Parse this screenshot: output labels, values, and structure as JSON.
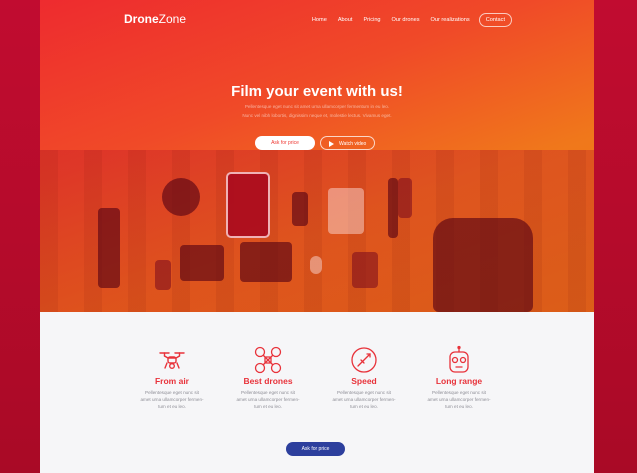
{
  "brand": {
    "bold": "Drone",
    "light": "Zone"
  },
  "nav": [
    "Home",
    "About",
    "Pricing",
    "Our drones",
    "Our realizations",
    "Contact"
  ],
  "hero": {
    "title": "Film your event with us!",
    "subtitle_1": "Pellentesque eget nunc sit amet urna ullamcorper fermentum in eu leo.",
    "subtitle_2": "Nunc vel nibh lobortis, dignissim neque et, molestie lectus. Vivamus eget.",
    "ask_label": "Ask for price",
    "video_label": "Watch video"
  },
  "features": [
    {
      "icon": "drone-icon",
      "title": "From air",
      "text_1": "Pellentesque eget nunc sit",
      "text_2": "amet urna ullamcorper fermen-",
      "text_3": "tum et eu leo."
    },
    {
      "icon": "quadcopter-icon",
      "title": "Best drones",
      "text_1": "Pellentesque eget nunc sit",
      "text_2": "amet urna ullamcorper fermen-",
      "text_3": "tum et eu leo."
    },
    {
      "icon": "speed-icon",
      "title": "Speed",
      "text_1": "Pellentesque eget nunc sit",
      "text_2": "amet urna ullamcorper fermen-",
      "text_3": "tum et eu leo."
    },
    {
      "icon": "controller-icon",
      "title": "Long range",
      "text_1": "Pellentesque eget nunc sit",
      "text_2": "amet urna ullamcorper fermen-",
      "text_3": "tum et eu leo."
    }
  ],
  "cta_label": "Ask for price",
  "colors": {
    "accent_red": "#e8323a",
    "accent_orange": "#f0771b",
    "cta_blue": "#2d3f9d"
  }
}
